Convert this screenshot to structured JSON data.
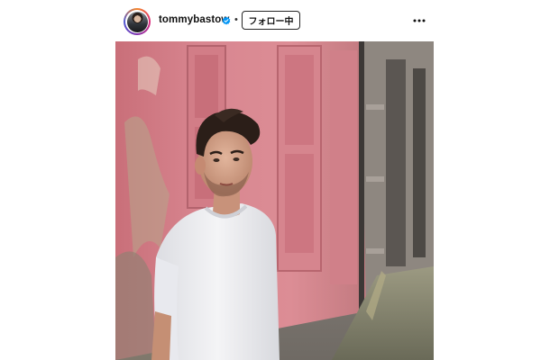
{
  "post": {
    "username": "tommybastow",
    "verified": true,
    "separator": "•",
    "follow_label": "フォロー中",
    "avatar_icon": "profile-avatar",
    "more_icon": "more-horizontal-icon",
    "verified_color": "#0095f6"
  },
  "photo": {
    "description_icon": "post-photo",
    "wall_color": "#d7878f",
    "shirt_color": "#f2f2f4"
  }
}
